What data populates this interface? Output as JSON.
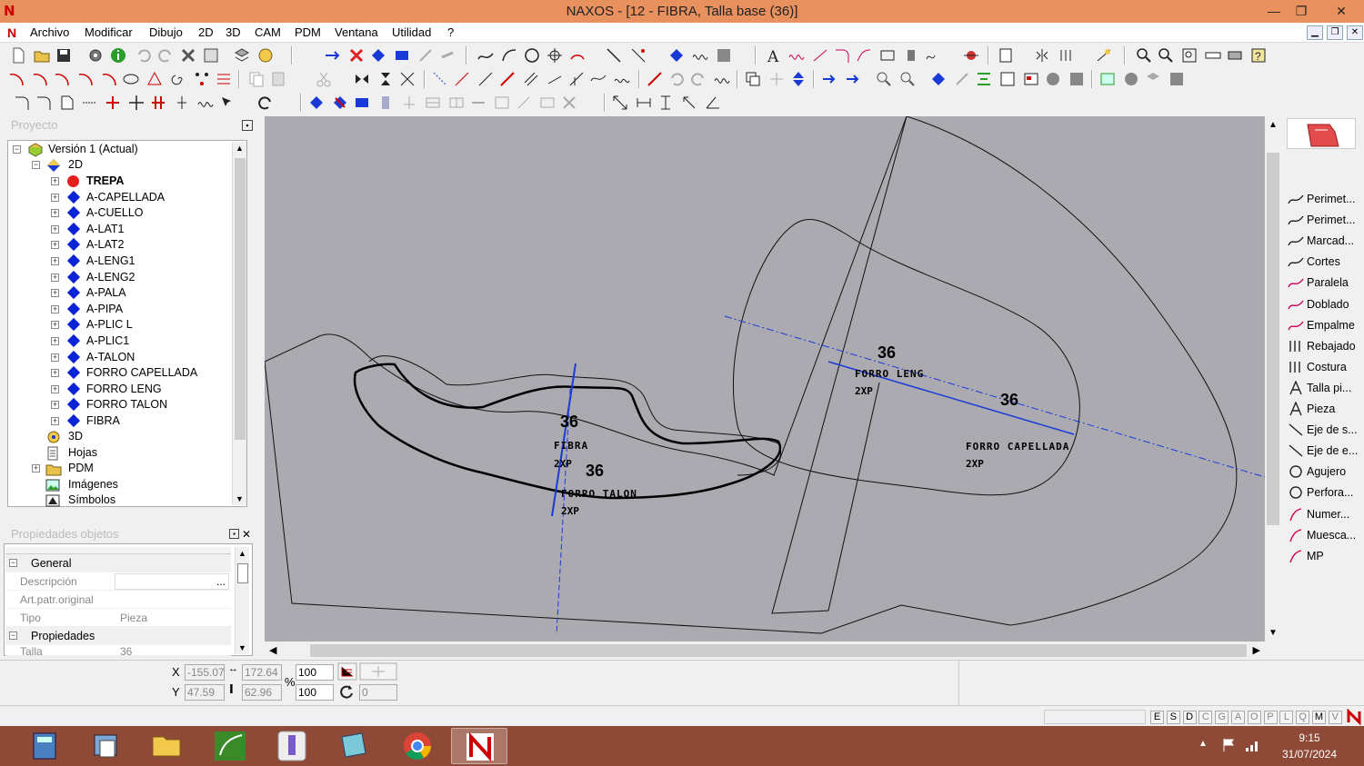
{
  "window": {
    "title": "NAXOS - [12 - FIBRA, Talla base (36)]",
    "minimize": "—",
    "maximize": "❐",
    "close": "✕",
    "app_icon": "N"
  },
  "menu": {
    "items": [
      "Archivo",
      "Modificar",
      "Dibujo",
      "2D",
      "3D",
      "CAM",
      "PDM",
      "Ventana",
      "Utilidad",
      "?"
    ]
  },
  "project": {
    "title": "Proyecto",
    "root": "Versión 1 (Actual)",
    "folder_2d": "2D",
    "pieces": [
      {
        "label": "TREPA",
        "active": true
      },
      {
        "label": "A-CAPELLADA"
      },
      {
        "label": "A-CUELLO"
      },
      {
        "label": "A-LAT1"
      },
      {
        "label": "A-LAT2"
      },
      {
        "label": "A-LENG1"
      },
      {
        "label": "A-LENG2"
      },
      {
        "label": "A-PALA"
      },
      {
        "label": "A-PIPA"
      },
      {
        "label": "A-PLIC L"
      },
      {
        "label": "A-PLIC1"
      },
      {
        "label": "A-TALON"
      },
      {
        "label": "FORRO CAPELLADA"
      },
      {
        "label": "FORRO LENG"
      },
      {
        "label": "FORRO TALON"
      },
      {
        "label": "FIBRA"
      }
    ],
    "other": [
      "3D",
      "Hojas",
      "PDM",
      "Imágenes",
      "Símbolos"
    ]
  },
  "properties": {
    "title": "Propiedades objetos",
    "general": "General",
    "rows": [
      {
        "name": "Descripción",
        "value": "",
        "button": "..."
      },
      {
        "name": "Art.patr.original",
        "value": ""
      },
      {
        "name": "Tipo",
        "value": "Pieza"
      }
    ],
    "section2": "Propiedades",
    "talla": {
      "name": "Talla",
      "value": "36"
    }
  },
  "canvas_labels": [
    {
      "size": "36",
      "name": "FIBRA",
      "qty": "2XP"
    },
    {
      "size": "36",
      "name": "FORRO TALON",
      "qty": "2XP"
    },
    {
      "size": "36",
      "name": "FORRO LENG",
      "qty": "2XP"
    },
    {
      "size": "36",
      "name": "FORRO CAPELLADA",
      "qty": "2XP"
    }
  ],
  "right_panel": {
    "items": [
      "Perimet...",
      "Perimet...",
      "Marcad...",
      "Cortes",
      "Paralela",
      "Doblado",
      "Empalme",
      "Rebajado",
      "Costura",
      "Talla pi...",
      "Pieza",
      "Eje de s...",
      "Eje de e...",
      "Agujero",
      "Perfora...",
      "Numer...",
      "Muesca...",
      "MP"
    ]
  },
  "coords": {
    "x_label": "X",
    "y_label": "Y",
    "x": "-155.07",
    "y": "47.59",
    "w": "172.64",
    "h": "62.96",
    "pct_label": "%",
    "scale_x": "100",
    "scale_y": "100",
    "rotation": "0"
  },
  "status_modes": [
    "E",
    "S",
    "D",
    "C",
    "G",
    "A",
    "O",
    "P",
    "L",
    "Q",
    "M",
    "V"
  ],
  "taskbar": {
    "time": "9:15",
    "date": "31/07/2024"
  },
  "colors": {
    "canvas": "#abaab0",
    "title": "#e9905f",
    "taskbar": "#8e4a37",
    "accent_blue": "#0a22d8"
  }
}
